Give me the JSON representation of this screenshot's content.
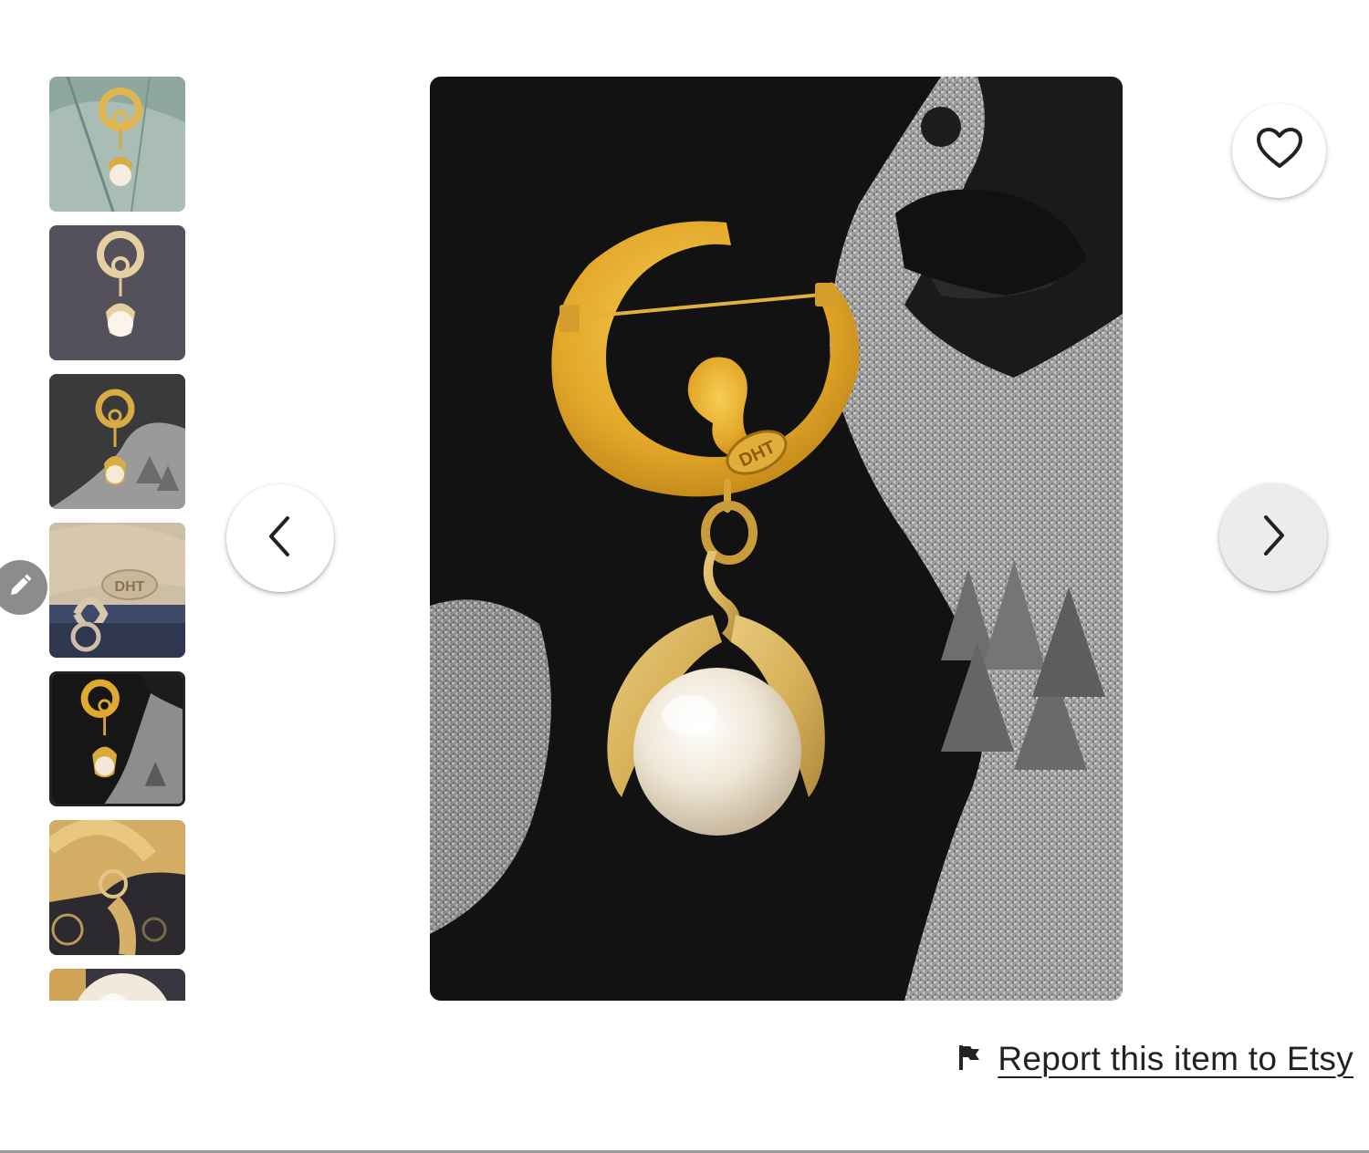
{
  "gallery": {
    "thumbnails": [
      {
        "name": "thumbnail-1",
        "selected": false
      },
      {
        "name": "thumbnail-2",
        "selected": false
      },
      {
        "name": "thumbnail-3",
        "selected": false
      },
      {
        "name": "thumbnail-4",
        "selected": false
      },
      {
        "name": "thumbnail-5",
        "selected": true
      },
      {
        "name": "thumbnail-6",
        "selected": false
      },
      {
        "name": "thumbnail-7",
        "selected": false
      }
    ],
    "icons": {
      "previous": "chevron-left-icon",
      "next": "chevron-right-icon",
      "favorite": "heart-icon",
      "edit": "pencil-icon",
      "report": "flag-icon"
    }
  },
  "report": {
    "label": "Report this item to Etsy"
  },
  "colors": {
    "text": "#222222",
    "gold": "#d9a93a",
    "edit_badge": "#8c8c8c"
  }
}
